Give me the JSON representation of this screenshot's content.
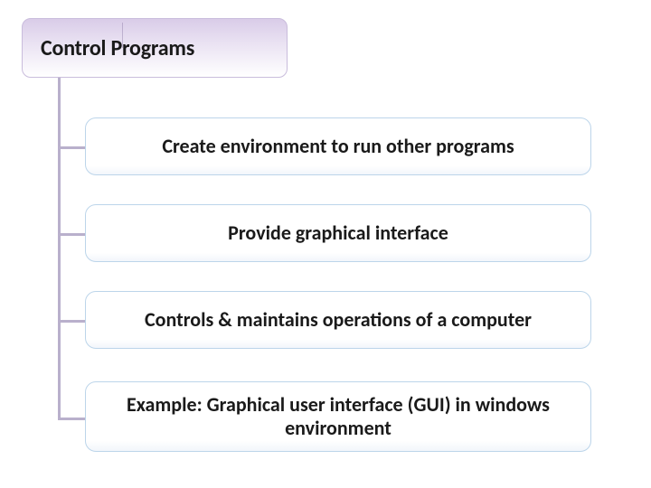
{
  "header": {
    "title": "Control Programs"
  },
  "items": [
    {
      "label": "Create environment to run other programs"
    },
    {
      "label": "Provide graphical interface"
    },
    {
      "label": "Controls & maintains operations of a computer"
    },
    {
      "label": "Example: Graphical user interface (GUI) in windows environment"
    }
  ],
  "colors": {
    "header_gradient_top": "#d9cce8",
    "connector": "#b9b0cc",
    "child_border": "#bcd5ea"
  }
}
